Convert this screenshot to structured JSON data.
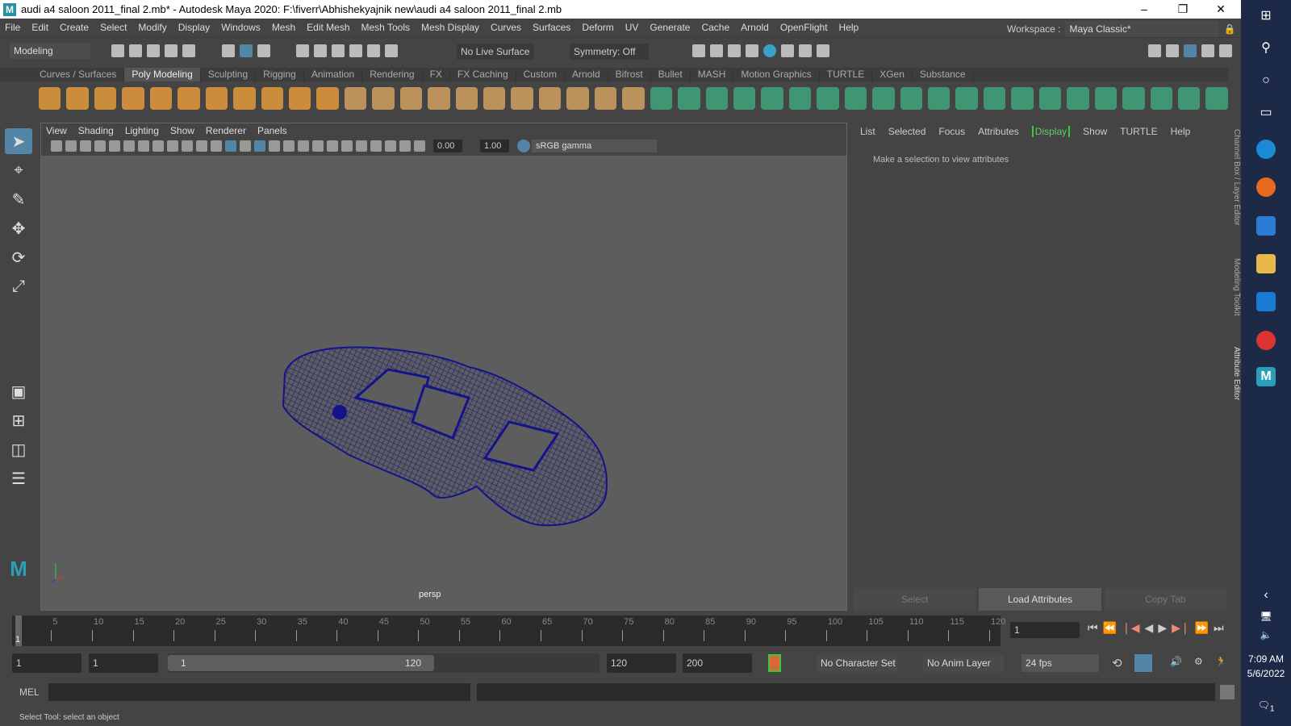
{
  "title": "audi a4 saloon 2011_final 2.mb* - Autodesk Maya 2020: F:\\fiverr\\Abhishekyajnik new\\audi a4 saloon 2011_final 2.mb",
  "logo": "M",
  "window_controls": {
    "minimize": "–",
    "restore": "❐",
    "close": "✕"
  },
  "menu": [
    "File",
    "Edit",
    "Create",
    "Select",
    "Modify",
    "Display",
    "Windows",
    "Mesh",
    "Edit Mesh",
    "Mesh Tools",
    "Mesh Display",
    "Curves",
    "Surfaces",
    "Deform",
    "UV",
    "Generate",
    "Cache",
    "Arnold",
    "OpenFlight",
    "Help"
  ],
  "workspace": {
    "label": "Workspace :",
    "value": "Maya Classic*"
  },
  "status_line": {
    "mode": "Modeling",
    "live_surface": "No Live Surface",
    "symmetry": "Symmetry: Off"
  },
  "shelf_tabs": [
    "Curves / Surfaces",
    "Poly Modeling",
    "Sculpting",
    "Rigging",
    "Animation",
    "Rendering",
    "FX",
    "FX Caching",
    "Custom",
    "Arnold",
    "Bifrost",
    "Bullet",
    "MASH",
    "Motion Graphics",
    "TURTLE",
    "XGen",
    "Substance"
  ],
  "shelf_active": "Poly Modeling",
  "viewport": {
    "menu": [
      "View",
      "Shading",
      "Lighting",
      "Show",
      "Renderer",
      "Panels"
    ],
    "exposure": "0.00",
    "gamma": "1.00",
    "color_space": "sRGB gamma",
    "camera": "persp"
  },
  "attribute_editor": {
    "menu": [
      "List",
      "Selected",
      "Focus",
      "Attributes",
      "Display",
      "Show",
      "TURTLE",
      "Help"
    ],
    "message": "Make a selection to view attributes",
    "buttons": [
      "Select",
      "Load Attributes",
      "Copy Tab"
    ]
  },
  "side_tabs": [
    "Channel Box / Layer Editor",
    "Modeling Toolkit",
    "Attribute Editor"
  ],
  "timeline": {
    "ticks": [
      5,
      10,
      15,
      20,
      25,
      30,
      35,
      40,
      45,
      50,
      55,
      60,
      65,
      70,
      75,
      80,
      85,
      90,
      95,
      100,
      105,
      110,
      115,
      120
    ],
    "current_marker": "1",
    "current_frame": "1"
  },
  "range": {
    "start": "1",
    "inner_start": "1",
    "slider_start": "1",
    "slider_end": "120",
    "end": "120",
    "max": "200",
    "character_set": "No Character Set",
    "anim_layer": "No Anim Layer",
    "fps": "24 fps"
  },
  "mel": {
    "label": "MEL"
  },
  "help_line": "Select Tool: select an object",
  "taskbar": {
    "time": "7:09 AM",
    "date": "5/6/2022",
    "notifications": "1"
  },
  "colors": {
    "mesh": "#14148a",
    "viewport_bg": "#5d5d5d",
    "accent": "#5285a6"
  }
}
